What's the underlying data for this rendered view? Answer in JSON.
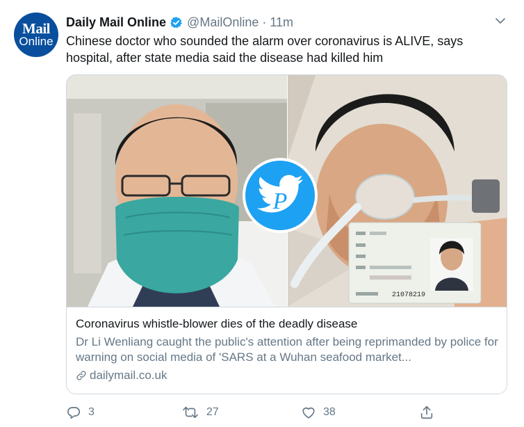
{
  "account": {
    "name": "Daily Mail Online",
    "handle": "@MailOnline",
    "separator": "·",
    "time": "11m",
    "avatar_line1": "Mail",
    "avatar_line2": "Online"
  },
  "tweet": {
    "text": "Chinese doctor who sounded the alarm over coronavirus is ALIVE, says hospital, after state media said the disease had killed him"
  },
  "card": {
    "title": "Coronavirus whistle-blower dies of the deadly disease",
    "description": "Dr Li Wenliang caught the public's attention after being reprimanded by police for warning on social media of 'SARS at a Wuhan seafood market...",
    "domain": "dailymail.co.uk",
    "id_card_number": "21078219"
  },
  "actions": {
    "reply_count": "3",
    "retweet_count": "27",
    "like_count": "38"
  },
  "icons": {
    "verified": "verified-badge-icon",
    "caret": "chevron-down-icon",
    "reply": "reply-icon",
    "retweet": "retweet-icon",
    "like": "heart-icon",
    "share": "share-icon",
    "link": "link-icon",
    "watermark": "bird-watermark-icon"
  },
  "colors": {
    "accent": "#1da1f2",
    "text_primary": "#14171a",
    "text_secondary": "#657786",
    "border": "#cfd9de",
    "avatar_bg": "#0a4f9e"
  }
}
